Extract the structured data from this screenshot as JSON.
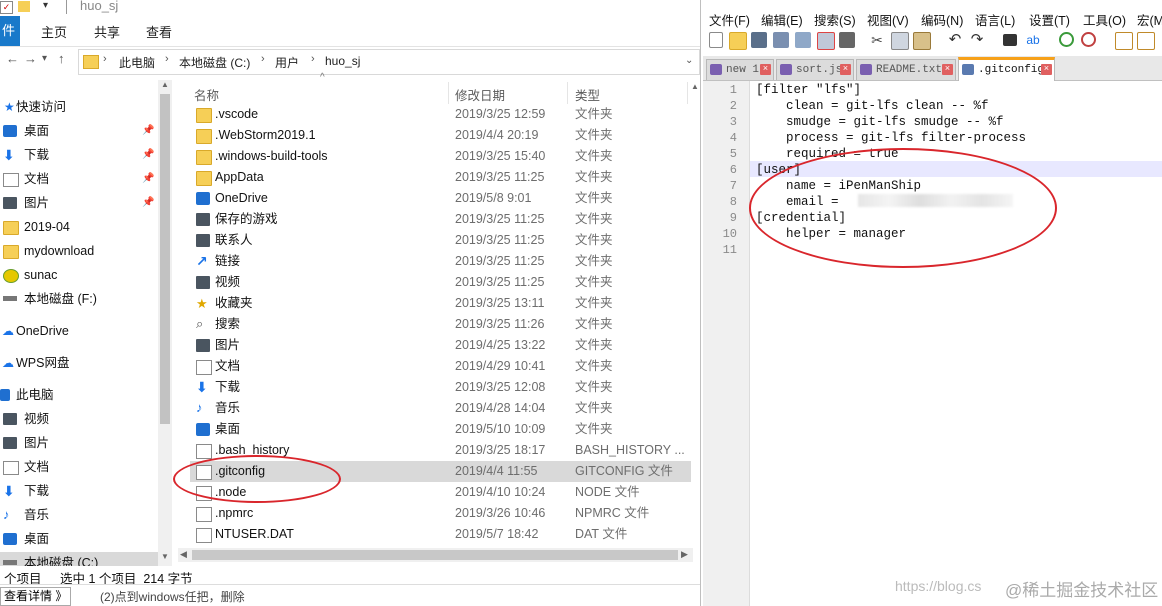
{
  "explorer": {
    "title": "huo_sj",
    "ribbon_tabs": [
      "件",
      "主页",
      "共享",
      "查看"
    ],
    "breadcrumb": [
      "此电脑",
      "本地磁盘 (C:)",
      "用户",
      "huo_sj"
    ],
    "nav_items": [
      {
        "label": "快速访问",
        "icon": "star-icon",
        "pinned": false
      },
      {
        "label": "桌面",
        "icon": "desktop-icon",
        "pinned": true
      },
      {
        "label": "下载",
        "icon": "download-icon",
        "pinned": true
      },
      {
        "label": "文档",
        "icon": "document-icon",
        "pinned": true
      },
      {
        "label": "图片",
        "icon": "picture-icon",
        "pinned": true
      },
      {
        "label": "2019-04",
        "icon": "folder-icon",
        "pinned": false
      },
      {
        "label": "mydownload",
        "icon": "folder-icon",
        "pinned": false
      },
      {
        "label": "sunac",
        "icon": "folder-icon",
        "pinned": false
      },
      {
        "label": "本地磁盘 (F:)",
        "icon": "drive-icon",
        "pinned": false
      },
      {
        "label": "",
        "icon": "",
        "pinned": false
      },
      {
        "label": "OneDrive",
        "icon": "onedrive-icon",
        "pinned": false
      },
      {
        "label": "",
        "icon": "",
        "pinned": false
      },
      {
        "label": "WPS网盘",
        "icon": "cloud-icon",
        "pinned": false
      },
      {
        "label": "",
        "icon": "",
        "pinned": false
      },
      {
        "label": "此电脑",
        "icon": "computer-icon",
        "pinned": false
      },
      {
        "label": "视频",
        "icon": "video-icon",
        "pinned": false
      },
      {
        "label": "图片",
        "icon": "picture-icon",
        "pinned": false
      },
      {
        "label": "文档",
        "icon": "document-icon",
        "pinned": false
      },
      {
        "label": "下载",
        "icon": "download-icon",
        "pinned": false
      },
      {
        "label": "音乐",
        "icon": "music-icon",
        "pinned": false
      },
      {
        "label": "桌面",
        "icon": "desktop-icon",
        "pinned": false
      },
      {
        "label": "本地磁盘 (C:)",
        "icon": "drive-icon",
        "pinned": false
      }
    ],
    "columns": {
      "name": "名称",
      "date": "修改日期",
      "type": "类型"
    },
    "files": [
      {
        "name": ".vscode",
        "date": "2019/3/25 12:59",
        "type": "文件夹",
        "icon": "folder",
        "selected": false
      },
      {
        "name": ".WebStorm2019.1",
        "date": "2019/4/4 20:19",
        "type": "文件夹",
        "icon": "folder",
        "selected": false
      },
      {
        "name": ".windows-build-tools",
        "date": "2019/3/25 15:40",
        "type": "文件夹",
        "icon": "folder",
        "selected": false
      },
      {
        "name": "AppData",
        "date": "2019/3/25 11:25",
        "type": "文件夹",
        "icon": "folder",
        "selected": false
      },
      {
        "name": "OneDrive",
        "date": "2019/5/8 9:01",
        "type": "文件夹",
        "icon": "onedrive",
        "selected": false
      },
      {
        "name": "保存的游戏",
        "date": "2019/3/25 11:25",
        "type": "文件夹",
        "icon": "game",
        "selected": false
      },
      {
        "name": "联系人",
        "date": "2019/3/25 11:25",
        "type": "文件夹",
        "icon": "contacts",
        "selected": false
      },
      {
        "name": "链接",
        "date": "2019/3/25 11:25",
        "type": "文件夹",
        "icon": "link",
        "selected": false
      },
      {
        "name": "视频",
        "date": "2019/3/25 11:25",
        "type": "文件夹",
        "icon": "video",
        "selected": false
      },
      {
        "name": "收藏夹",
        "date": "2019/3/25 13:11",
        "type": "文件夹",
        "icon": "star",
        "selected": false
      },
      {
        "name": "搜索",
        "date": "2019/3/25 11:26",
        "type": "文件夹",
        "icon": "search",
        "selected": false
      },
      {
        "name": "图片",
        "date": "2019/4/25 13:22",
        "type": "文件夹",
        "icon": "picture",
        "selected": false
      },
      {
        "name": "文档",
        "date": "2019/4/29 10:41",
        "type": "文件夹",
        "icon": "document",
        "selected": false
      },
      {
        "name": "下载",
        "date": "2019/3/25 12:08",
        "type": "文件夹",
        "icon": "download",
        "selected": false
      },
      {
        "name": "音乐",
        "date": "2019/4/28 14:04",
        "type": "文件夹",
        "icon": "music",
        "selected": false
      },
      {
        "name": "桌面",
        "date": "2019/5/10 10:09",
        "type": "文件夹",
        "icon": "desktop",
        "selected": false
      },
      {
        "name": ".bash_history",
        "date": "2019/3/25 18:17",
        "type": "BASH_HISTORY ...",
        "icon": "file",
        "selected": false
      },
      {
        "name": ".gitconfig",
        "date": "2019/4/4 11:55",
        "type": "GITCONFIG 文件",
        "icon": "file",
        "selected": true
      },
      {
        "name": ".node",
        "date": "2019/4/10 10:24",
        "type": "NODE 文件",
        "icon": "file",
        "selected": false
      },
      {
        "name": ".npmrc",
        "date": "2019/3/26 10:46",
        "type": "NPMRC 文件",
        "icon": "file",
        "selected": false
      },
      {
        "name": "NTUSER.DAT",
        "date": "2019/5/7 18:42",
        "type": "DAT 文件",
        "icon": "file",
        "selected": false
      }
    ],
    "status": {
      "count": "个项目",
      "selected": "选中 1 个项目  214 字节"
    },
    "detail_button": "查看详情 》",
    "bottom_hint": "(2)点到windows任把，删除"
  },
  "npp": {
    "menu": [
      "文件(F)",
      "编辑(E)",
      "搜索(S)",
      "视图(V)",
      "编码(N)",
      "语言(L)",
      "设置(T)",
      "工具(O)",
      "宏(M"
    ],
    "tabs": [
      {
        "label": "new 1",
        "active": false
      },
      {
        "label": "sort.js",
        "active": false
      },
      {
        "label": "README.txt",
        "active": false
      },
      {
        "label": ".gitconfig",
        "active": true
      }
    ],
    "lines": [
      "[filter \"lfs\"]",
      "    clean = git-lfs clean -- %f",
      "    smudge = git-lfs smudge -- %f",
      "    process = git-lfs filter-process",
      "    required = true",
      "[user]",
      "    name = iPenManShip",
      "    email = ",
      "[credential]",
      "    helper = manager",
      ""
    ],
    "line_numbers": [
      "1",
      "2",
      "3",
      "4",
      "5",
      "6",
      "7",
      "8",
      "9",
      "10",
      "11"
    ]
  },
  "watermark": {
    "url": "https://blog.cs",
    "brand": "@稀土掘金技术社区"
  },
  "colors": {
    "annotation_red": "#d9262c",
    "tab_accent": "#f7a11a",
    "selection": "#d9d9d9",
    "ribbon_blue": "#1979ca"
  }
}
